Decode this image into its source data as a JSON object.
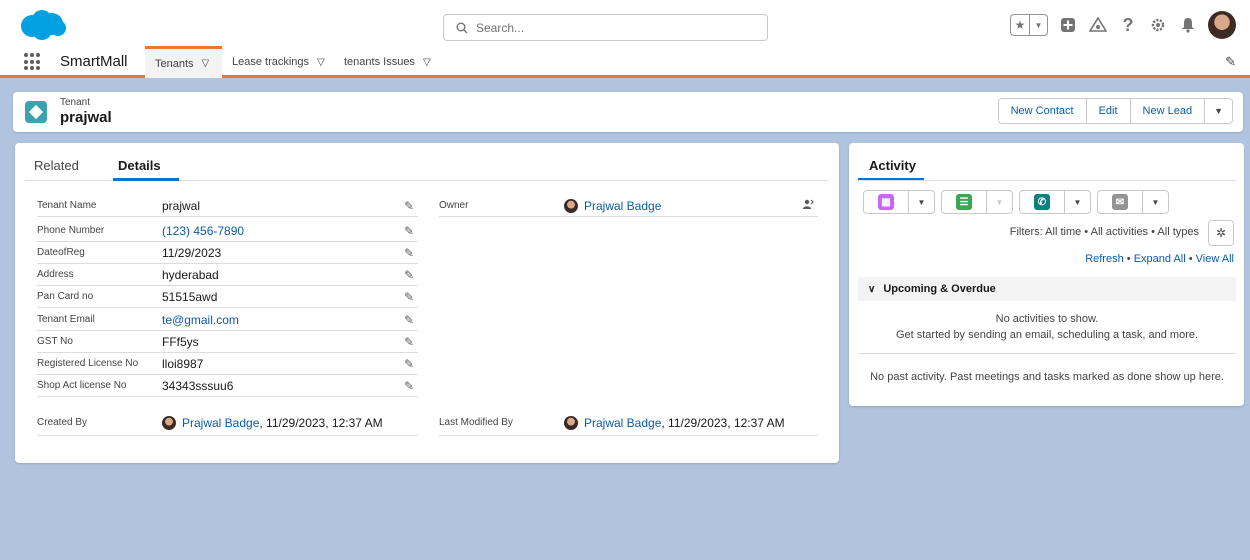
{
  "header": {
    "search_placeholder": "Search...",
    "icons": [
      "favorites-star-icon",
      "favorites-dropdown-icon",
      "global-add-icon",
      "trailhead-icon",
      "help-icon",
      "setup-gear-icon",
      "notifications-bell-icon",
      "user-avatar"
    ]
  },
  "nav": {
    "app_name": "SmartMall",
    "tabs": [
      {
        "label": "Tenants",
        "active": true
      },
      {
        "label": "Lease trackings",
        "active": false
      },
      {
        "label": "tenants Issues",
        "active": false
      }
    ]
  },
  "record": {
    "type": "Tenant",
    "name": "prajwal",
    "actions": [
      "New Contact",
      "Edit",
      "New Lead"
    ]
  },
  "details": {
    "tabs": [
      "Related",
      "Details"
    ],
    "active_tab": "Details",
    "fields": [
      {
        "label": "Tenant Name",
        "value": "prajwal"
      },
      {
        "label": "Phone Number",
        "value": "(123) 456-7890"
      },
      {
        "label": "DateofReg",
        "value": "11/29/2023"
      },
      {
        "label": "Address",
        "value": "hyderabad"
      },
      {
        "label": "Pan Card no",
        "value": "51515awd"
      },
      {
        "label": "Tenant Email",
        "value": "te@gmail.com"
      },
      {
        "label": "GST No",
        "value": "FFf5ys"
      },
      {
        "label": "Registered License No",
        "value": "lloi8987"
      },
      {
        "label": "Shop Act license No",
        "value": "34343sssuu6"
      }
    ],
    "owner": {
      "label": "Owner",
      "value": "Prajwal Badge"
    },
    "created_by": {
      "label": "Created By",
      "user": "Prajwal Badge",
      "date": ", 11/29/2023, 12:37 AM"
    },
    "last_modified_by": {
      "label": "Last Modified By",
      "user": "Prajwal Badge",
      "date": ", 11/29/2023, 12:37 AM"
    }
  },
  "activity": {
    "tab": "Activity",
    "filters": "Filters: All time • All activities • All types",
    "links": {
      "refresh": "Refresh",
      "expand_all": "Expand All",
      "view_all": "View All"
    },
    "upcoming_title": "Upcoming & Overdue",
    "no_activities": "No activities to show.",
    "get_started": "Get started by sending an email, scheduling a task, and more.",
    "no_past": "No past activity. Past meetings and tasks marked as done show up here.",
    "colors": {
      "event": "#cb65ff",
      "task": "#3ba755",
      "call": "#0b827c",
      "email": "#939393"
    }
  },
  "colors": {
    "accent": "#e07b39",
    "link": "#0b5cab",
    "brand": "#0176d3",
    "tenant_icon": "#3ba3ad",
    "background": "#b0c4df"
  }
}
